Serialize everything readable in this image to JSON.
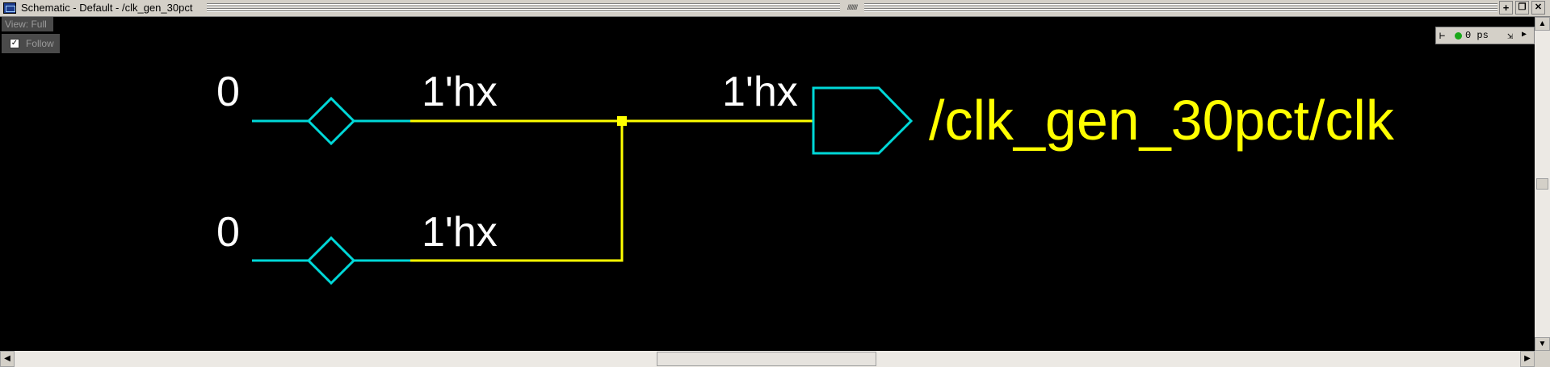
{
  "window": {
    "title": "Schematic - Default  - /clk_gen_30pct",
    "grip_center": "////////"
  },
  "title_buttons": {
    "add": "+",
    "restore": "❐",
    "close": "✕"
  },
  "overlay": {
    "view_label": "View: Full",
    "follow_label": "Follow",
    "follow_checked": "✓"
  },
  "mini_toolbar": {
    "time": "0 ps"
  },
  "schematic": {
    "inputs": [
      {
        "value": "0",
        "net_value": "1'hx"
      },
      {
        "value": "0",
        "net_value": "1'hx"
      }
    ],
    "output_net_value": "1'hx",
    "signal_name": "/clk_gen_30pct/clk"
  },
  "colors": {
    "canvas": "#000000",
    "input_symbol": "#00d8d8",
    "wire": "#ffff00",
    "text_white": "#ffffff",
    "signal_text": "#ffff00"
  },
  "icons": {
    "window": "schematic-window-icon",
    "cursor": "cursor-icon",
    "status_dot": "green-status-dot-icon",
    "step": "step-icon",
    "scroll_left": "arrow-left-icon",
    "scroll_right": "arrow-right-icon",
    "scroll_up": "arrow-up-icon",
    "scroll_down": "arrow-down-icon"
  }
}
